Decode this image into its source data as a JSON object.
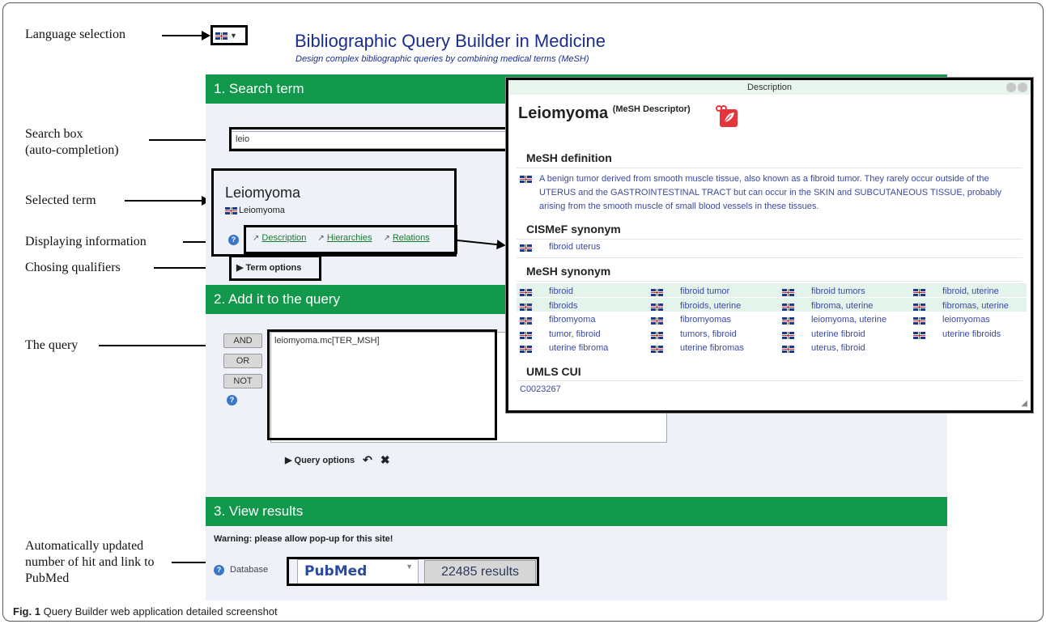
{
  "annotations": {
    "language": "Language selection",
    "search_box_l1": "Search box",
    "search_box_l2": "(auto-completion)",
    "selected_term": "Selected term",
    "displaying_info": "Displaying information",
    "choosing_qualifiers": "Chosing qualifiers",
    "the_query": "The query",
    "auto_updated_l1": "Automatically updated",
    "auto_updated_l2": "number of hit and link to",
    "auto_updated_l3": "PubMed"
  },
  "header": {
    "title": "Bibliographic Query Builder in Medicine",
    "subtitle": "Design complex bibliographic queries by combining medical terms (MeSH)",
    "language_icon": "uk-flag-icon"
  },
  "sections": {
    "search": "1. Search term",
    "add": "2. Add it to the query",
    "view": "3. View results"
  },
  "search": {
    "value": "leio"
  },
  "term": {
    "name": "Leiomyoma",
    "sub": "Leiomyoma",
    "links": [
      "Description",
      "Hierarchies",
      "Relations"
    ],
    "options": "Term options"
  },
  "query": {
    "operators": [
      "AND",
      "OR",
      "NOT"
    ],
    "text": "leiomyoma.mc[TER_MSH]",
    "options": "Query options"
  },
  "results": {
    "warning": "Warning: please allow pop-up for this site!",
    "db_label": "Database",
    "db_value": "PubMed",
    "count": "22485 results"
  },
  "dialog": {
    "bar_title": "Description",
    "title": "Leiomyoma",
    "title_sup": "(MeSH Descriptor)",
    "mesh_def_heading": "MeSH definition",
    "mesh_def_text": "A benign tumor derived from smooth muscle tissue, also known as a fibroid tumor. They rarely occur outside of the UTERUS and the GASTROINTESTINAL TRACT but can occur in the SKIN and SUBCUTANEOUS TISSUE, probably arising from the smooth muscle of small blood vessels in these tissues.",
    "cismef_heading": "CISMeF synonym",
    "cismef_synonym": "fibroid uterus",
    "mesh_syn_heading": "MeSH synonym",
    "mesh_synonyms": [
      [
        "fibroid",
        "fibroid tumor",
        "fibroid tumors",
        "fibroid, uterine"
      ],
      [
        "fibroids",
        "fibroids, uterine",
        "fibroma, uterine",
        "fibromas, uterine"
      ],
      [
        "fibromyoma",
        "fibromyomas",
        "leiomyoma, uterine",
        "leiomyomas"
      ],
      [
        "tumor, fibroid",
        "tumors, fibroid",
        "uterine fibroid",
        "uterine fibroids"
      ],
      [
        "uterine fibroma",
        "uterine fibromas",
        "uterus, fibroid",
        ""
      ]
    ],
    "umls_heading": "UMLS CUI",
    "umls_cui": "C0023267"
  },
  "caption": {
    "label": "Fig. 1",
    "text": "Query Builder web application detailed screenshot"
  }
}
